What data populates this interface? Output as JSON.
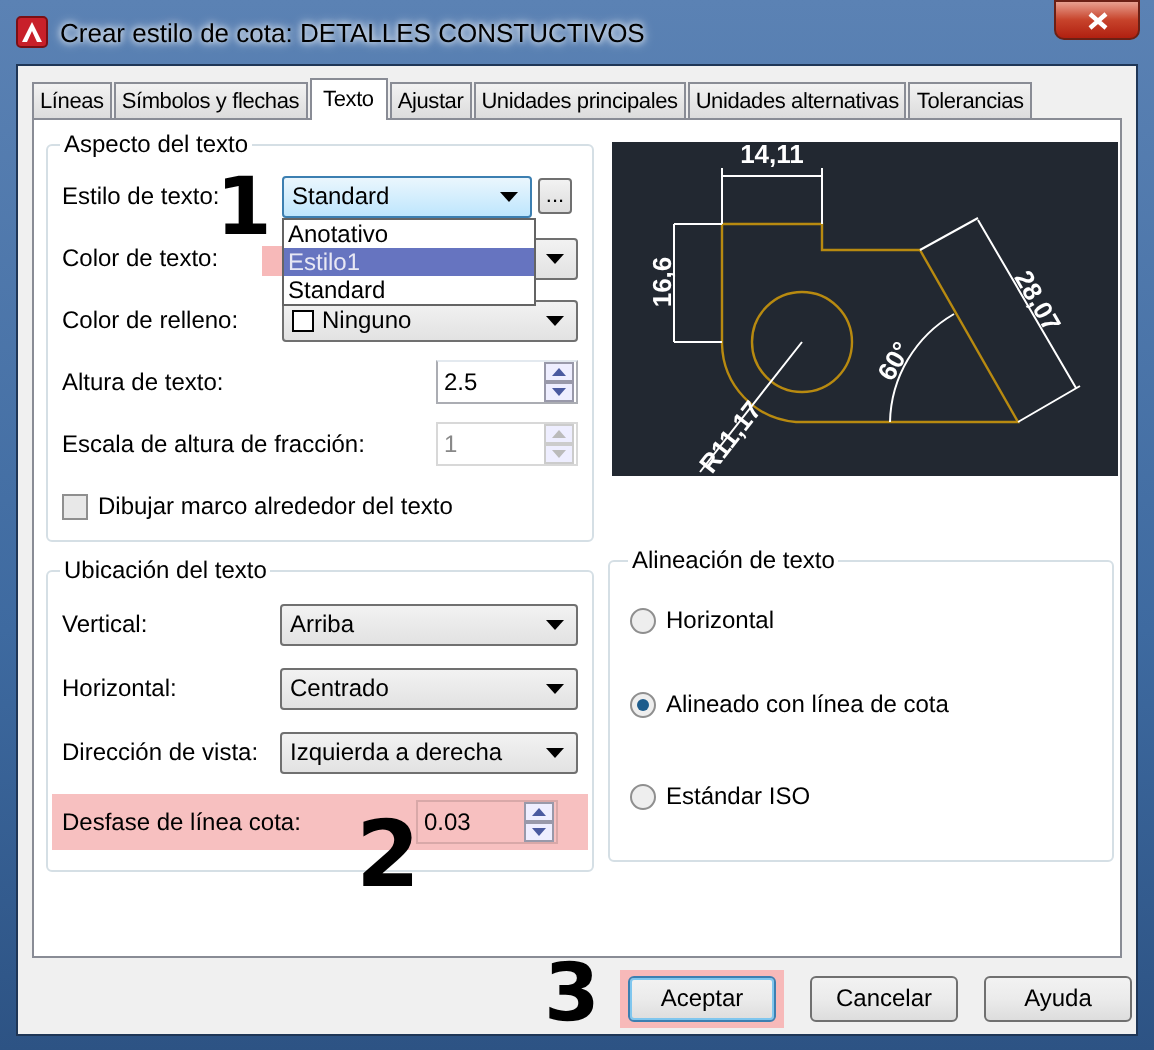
{
  "window": {
    "title": "Crear estilo de cota: DETALLES CONSTUCTIVOS"
  },
  "tabs": [
    {
      "label": "Líneas",
      "selected": false
    },
    {
      "label": "Símbolos y flechas",
      "selected": false
    },
    {
      "label": "Texto",
      "selected": true
    },
    {
      "label": "Ajustar",
      "selected": false
    },
    {
      "label": "Unidades principales",
      "selected": false
    },
    {
      "label": "Unidades alternativas",
      "selected": false
    },
    {
      "label": "Tolerancias",
      "selected": false
    }
  ],
  "text_appearance": {
    "title": "Aspecto del texto",
    "text_style": {
      "label": "Estilo de texto:",
      "value": "Standard",
      "browse_button": "...",
      "options": [
        {
          "label": "Anotativo",
          "hovered": false,
          "highlighted": false
        },
        {
          "label": "Estilo1",
          "hovered": true,
          "highlighted": true
        },
        {
          "label": "Standard",
          "hovered": false,
          "highlighted": false
        }
      ]
    },
    "text_color": {
      "label": "Color de texto:"
    },
    "fill_color": {
      "label": "Color de relleno:",
      "value": "Ninguno"
    },
    "text_height": {
      "label": "Altura de texto:",
      "value": "2.5",
      "disabled": false
    },
    "fraction_scale": {
      "label": "Escala de altura de fracción:",
      "value": "1",
      "disabled": true
    },
    "draw_frame": {
      "label": "Dibujar marco alrededor del texto",
      "checked": false
    }
  },
  "preview": {
    "labels": [
      "14,11",
      "16,6",
      "28,07",
      "60°",
      "R11,17"
    ]
  },
  "text_placement": {
    "title": "Ubicación del texto",
    "fields": [
      {
        "label": "Vertical:",
        "value": "Arriba"
      },
      {
        "label": "Horizontal:",
        "value": "Centrado"
      },
      {
        "label": "Dirección de vista:",
        "value": "Izquierda a derecha"
      }
    ],
    "offset": {
      "label": "Desfase de línea cota:",
      "value": "0.03",
      "highlighted": true
    }
  },
  "text_alignment": {
    "title": "Alineación de texto",
    "options": [
      {
        "label": "Horizontal",
        "selected": false
      },
      {
        "label": "Alineado con línea de cota",
        "selected": true
      },
      {
        "label": "Estándar ISO",
        "selected": false
      }
    ]
  },
  "buttons": [
    {
      "label": "Aceptar",
      "highlighted": true
    },
    {
      "label": "Cancelar",
      "highlighted": false
    },
    {
      "label": "Ayuda",
      "highlighted": false
    }
  ],
  "annotations": [
    "1",
    "2",
    "3"
  ]
}
